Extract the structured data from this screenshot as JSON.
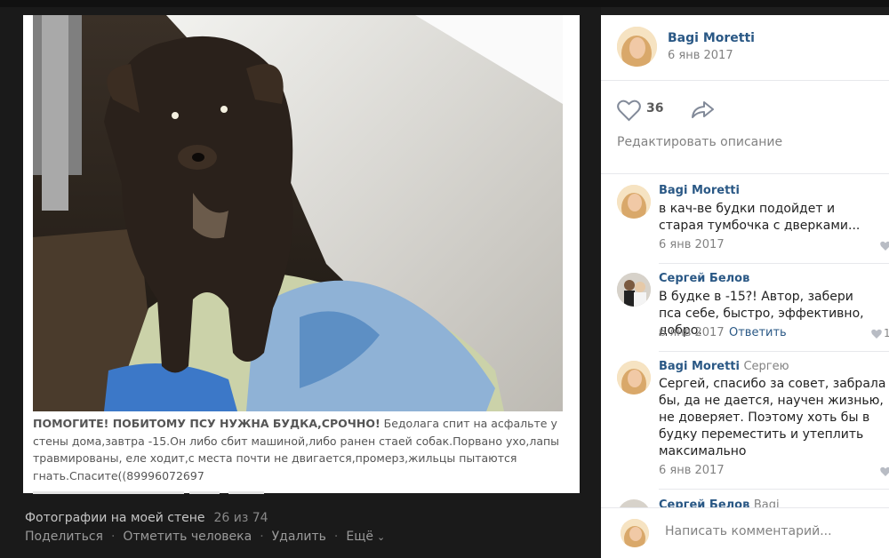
{
  "photo": {
    "caption_title": "ПОМОГИТЕ! ПОБИТОМУ ПСУ НУЖНА БУДКА,СРОЧНО!",
    "caption_body": " Бедолага спит на асфальте у стены дома,завтра -15.Он либо сбит машиной,либо ранен стаей собак.Порвано ухо,лапы травмированы, еле ходит,с места почти не двигается,промерз,жильцы пытаются гнать.Спасите((89996072697",
    "album_label": "Фотографии на моей стене",
    "counter": "26 из 74",
    "actions": [
      "Поделиться",
      "Отметить человека",
      "Удалить",
      "Ещё"
    ]
  },
  "post": {
    "author": "Bagi Moretti",
    "date": "6 янв 2017",
    "likes": "36",
    "edit_label": "Редактировать описание"
  },
  "comments": [
    {
      "author": "Bagi Moretti",
      "to": "",
      "text": "в кач-ве будки подойдет и старая тумбочка с дверками...",
      "date": "6 янв 2017",
      "reply": "",
      "likes": ""
    },
    {
      "author": "Сергей Белов",
      "to": "",
      "text": "В будке в -15?! Автор, забери пса себе, быстро, эффективно, добро.",
      "date": "6 янв 2017",
      "reply": "Ответить",
      "likes": "1"
    },
    {
      "author": "Bagi Moretti",
      "to": "Сергею",
      "text": "Сергей, спасибо за совет, забрала бы, да не дается, научен жизнью, не доверяет. Поэтому хоть бы в будку переместить и утеплить максимально",
      "date": "6 янв 2017",
      "reply": "",
      "likes": ""
    },
    {
      "author": "Сергей Белов",
      "to": "Bagi",
      "text": "",
      "date": "",
      "reply": "",
      "likes": ""
    }
  ],
  "comment_input": {
    "placeholder": "Написать комментарий..."
  },
  "colors": {
    "link": "#2a5885",
    "muted": "#828282",
    "bg_dark": "#1e1e1e"
  }
}
